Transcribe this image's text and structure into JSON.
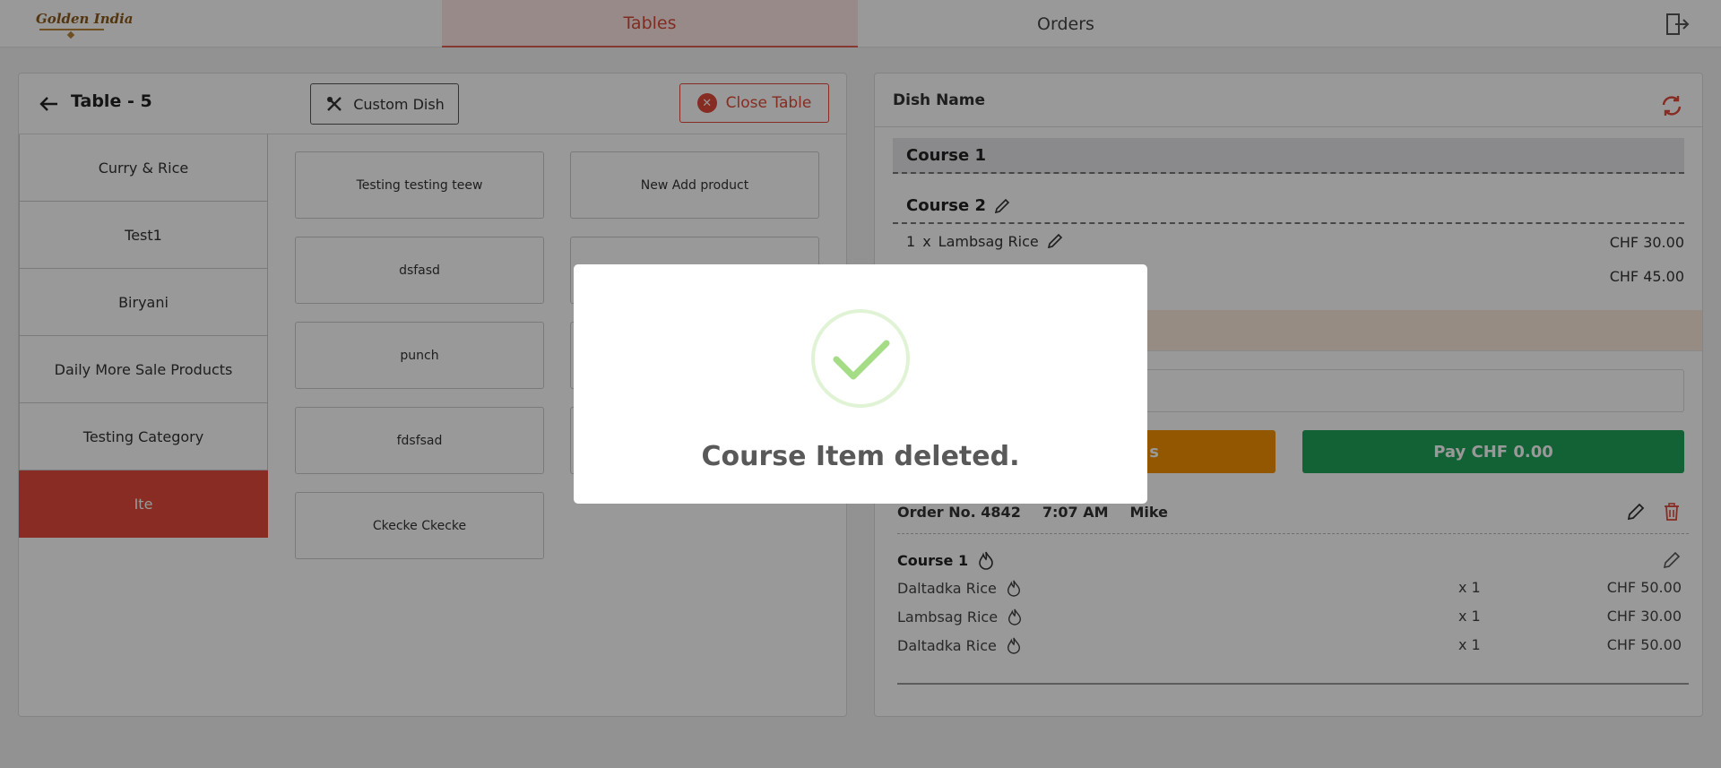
{
  "header": {
    "logo_text": "Golden India",
    "tabs": [
      {
        "label": "Tables",
        "active": true
      },
      {
        "label": "Orders",
        "active": false
      }
    ],
    "logout_icon": "logout-icon"
  },
  "table_panel": {
    "title": "Table - 5",
    "custom_dish_label": "Custom Dish",
    "close_table_label": "Close Table",
    "categories": [
      {
        "label": "Curry & Rice"
      },
      {
        "label": "Test1"
      },
      {
        "label": "Biryani"
      },
      {
        "label": "Daily More Sale Products"
      },
      {
        "label": "Testing Category"
      },
      {
        "label": "Ite",
        "active": true
      }
    ],
    "products": [
      {
        "label": "Testing testing teew"
      },
      {
        "label": "New Add product"
      },
      {
        "label": "dsfasd"
      },
      {
        "label": ""
      },
      {
        "label": "punch"
      },
      {
        "label": ""
      },
      {
        "label": "fdsfsad"
      },
      {
        "label": ""
      },
      {
        "label": "Ckecke Ckecke"
      }
    ]
  },
  "order_panel": {
    "dish_name_label": "Dish Name",
    "course1_label": "Course 1",
    "course2_label": "Course 2",
    "items": [
      {
        "qty": "1",
        "x": "x",
        "name": "Lambsag Rice",
        "price": "CHF 30.00"
      },
      {
        "qty": "",
        "x": "",
        "name": "",
        "price": "CHF 45.00"
      }
    ],
    "orange_button_partial": "s",
    "pay_label": "Pay CHF 0.00",
    "order": {
      "number": "Order No. 4842",
      "time": "7:07 AM",
      "waiter": "Mike",
      "course_label": "Course 1",
      "items": [
        {
          "name": "Daltadka Rice",
          "qty": "x 1",
          "price": "CHF 50.00"
        },
        {
          "name": "Lambsag Rice",
          "qty": "x 1",
          "price": "CHF 30.00"
        },
        {
          "name": "Daltadka Rice",
          "qty": "x 1",
          "price": "CHF 50.00"
        }
      ]
    }
  },
  "modal": {
    "message": "Course Item deleted.",
    "icon": "success-check-icon"
  },
  "colors": {
    "accent_red": "#e44a3c",
    "pay_green": "#1ea35a",
    "orange": "#f39200",
    "check_green": "#a5dc86"
  }
}
